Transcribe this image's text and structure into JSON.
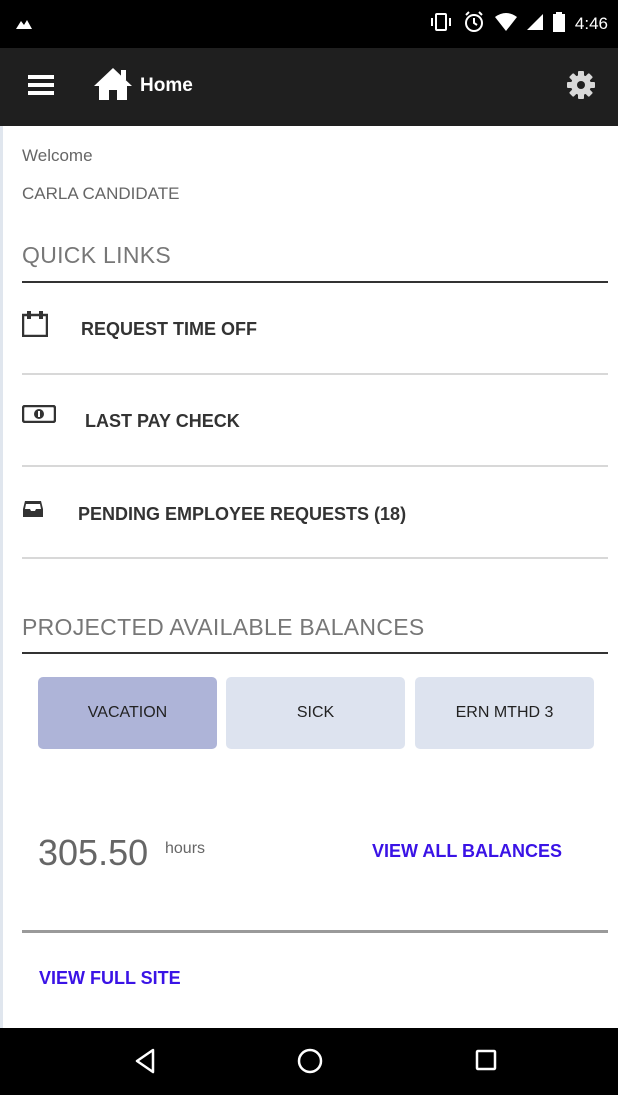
{
  "status_bar": {
    "time": "4:46"
  },
  "app_bar": {
    "title": "Home"
  },
  "greeting": {
    "welcome": "Welcome",
    "user_name": "CARLA CANDIDATE"
  },
  "quick_links": {
    "title": "QUICK LINKS",
    "items": [
      {
        "label": "REQUEST TIME OFF",
        "icon": "calendar-icon"
      },
      {
        "label": "LAST PAY CHECK",
        "icon": "money-icon"
      },
      {
        "label": "PENDING EMPLOYEE REQUESTS (18)",
        "icon": "inbox-icon"
      }
    ]
  },
  "balances": {
    "title": "PROJECTED AVAILABLE BALANCES",
    "tabs": [
      "VACATION",
      "SICK",
      "ERN MTHD 3"
    ],
    "selected_tab": "VACATION",
    "value": "305.50",
    "unit": "hours",
    "view_all_label": "VIEW ALL BALANCES"
  },
  "footer": {
    "full_site_label": "VIEW FULL SITE"
  },
  "colors": {
    "accent_link": "#3a13e6",
    "tab_active": "#aeb4d8",
    "tab_inactive": "#dde3ef",
    "app_bar": "#1f1f1f"
  }
}
